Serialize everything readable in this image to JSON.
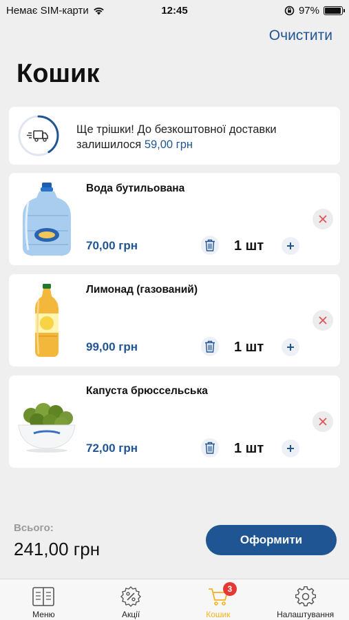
{
  "status_bar": {
    "carrier": "Немає SIM-карти",
    "time": "12:45",
    "battery": "97%",
    "battery_level": 0.97
  },
  "header": {
    "clear_label": "Очистити",
    "title": "Кошик"
  },
  "delivery": {
    "text": "Ще трішки! До безкоштовної доставки залишилося",
    "amount": "59,00 грн",
    "progress": 0.41
  },
  "cart": {
    "items": [
      {
        "name": "Вода бутильована",
        "price": "70,00 грн",
        "qty": "1 шт"
      },
      {
        "name": "Лимонад (газований)",
        "price": "99,00 грн",
        "qty": "1 шт"
      },
      {
        "name": "Капуста брюссельська",
        "price": "72,00 грн",
        "qty": "1 шт"
      }
    ]
  },
  "summary": {
    "total_label": "Всього:",
    "total_value": "241,00 грн",
    "checkout_label": "Оформити"
  },
  "tabs": [
    {
      "label": "Меню",
      "icon": "menu-book-icon"
    },
    {
      "label": "Акції",
      "icon": "percent-badge-icon"
    },
    {
      "label": "Кошик",
      "icon": "cart-icon",
      "badge": "3",
      "active": true
    },
    {
      "label": "Налаштування",
      "icon": "gear-icon"
    }
  ],
  "colors": {
    "brand": "#1f5593",
    "active_tab": "#f5b21d",
    "badge": "#e53935",
    "remove": "#e05555"
  }
}
